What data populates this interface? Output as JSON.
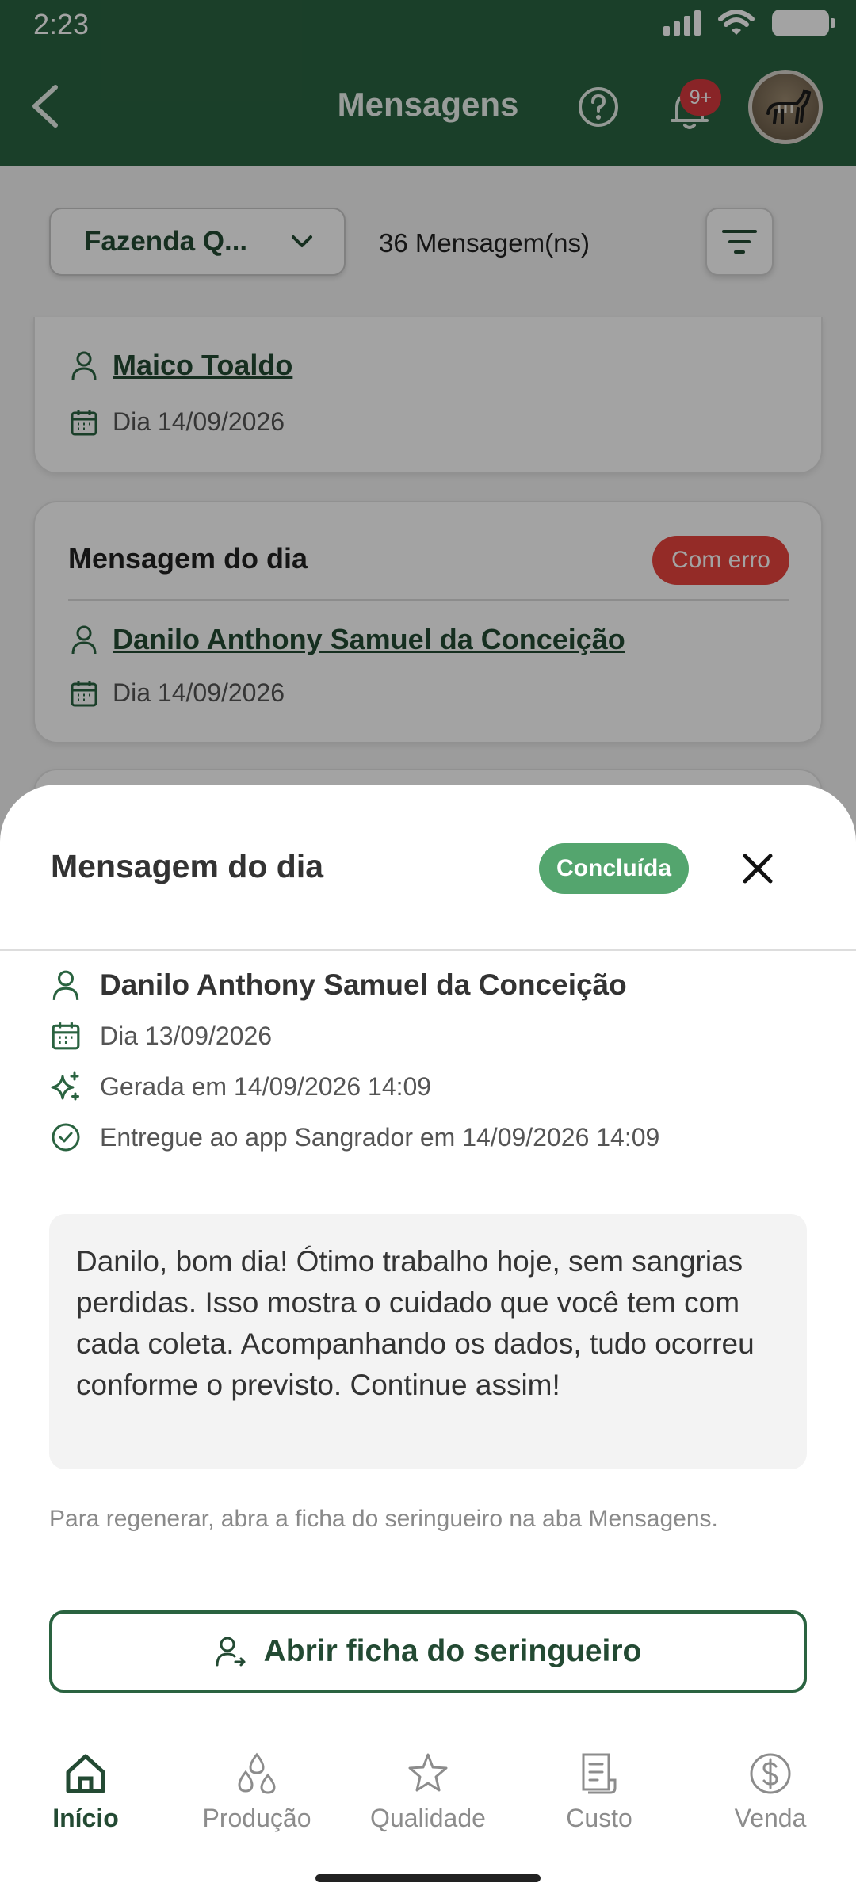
{
  "status_bar": {
    "time": "2:23"
  },
  "header": {
    "title": "Mensagens",
    "notification_badge": "9+"
  },
  "filter_bar": {
    "farm": "Fazenda Q...",
    "message_count": "36 Mensagem(ns)"
  },
  "list": {
    "items": [
      {
        "name": "Maico Toaldo",
        "date": "Dia 14/09/2026"
      },
      {
        "title": "Mensagem do dia",
        "status": "Com erro",
        "name": "Danilo Anthony Samuel da Conceição",
        "date": "Dia 14/09/2026"
      }
    ]
  },
  "sheet": {
    "title": "Mensagem do dia",
    "status": "Concluída",
    "worker_name": "Danilo Anthony Samuel da Conceição",
    "date": "Dia 13/09/2026",
    "generated": "Gerada em 14/09/2026 14:09",
    "delivered": "Entregue ao app Sangrador em 14/09/2026 14:09",
    "message": "Danilo, bom dia! Ótimo trabalho hoje, sem sangrias perdidas. Isso mostra o cuidado que você tem com cada coleta. Acompanhando os dados, tudo ocorreu conforme o previsto. Continue assim!",
    "hint": "Para regenerar, abra a ficha do seringueiro na aba Mensagens.",
    "open_button": "Abrir ficha do seringueiro"
  },
  "nav": {
    "items": [
      {
        "label": "Início",
        "icon": "home-icon",
        "active": true
      },
      {
        "label": "Produção",
        "icon": "drops-icon"
      },
      {
        "label": "Qualidade",
        "icon": "star-icon"
      },
      {
        "label": "Custo",
        "icon": "receipt-icon"
      },
      {
        "label": "Venda",
        "icon": "dollar-icon"
      }
    ]
  },
  "colors": {
    "primary": "#2a6340",
    "success": "#54a56e",
    "error": "#e8443e",
    "badge": "#d6393e"
  }
}
